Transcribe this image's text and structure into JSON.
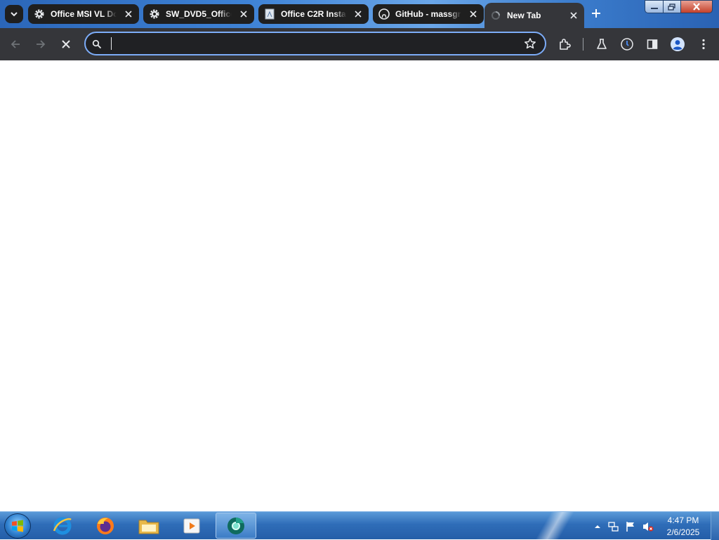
{
  "browser": {
    "tabs": [
      {
        "title": "Office MSI VL Do",
        "favicon": "gear-icon",
        "active": false
      },
      {
        "title": "SW_DVD5_Office",
        "favicon": "gear-icon",
        "active": false
      },
      {
        "title": "Office C2R Install",
        "favicon": "document-icon",
        "active": false
      },
      {
        "title": "GitHub - massgra",
        "favicon": "github-icon",
        "active": false
      },
      {
        "title": "New Tab",
        "favicon": "loading-icon",
        "active": true
      }
    ],
    "omnibox": {
      "value": "",
      "placeholder": ""
    },
    "toolbar_icons": [
      "back-icon",
      "forward-icon",
      "stop-icon",
      "bookmark-star-icon",
      "extensions-icon",
      "labs-icon",
      "performance-icon",
      "side-panel-icon",
      "profile-icon",
      "menu-icon"
    ]
  },
  "taskbar": {
    "pinned": [
      "internet-explorer-icon",
      "firefox-icon",
      "file-explorer-icon",
      "media-player-icon",
      "chrome-canary-icon"
    ],
    "tray_icons": [
      "show-hidden-icons",
      "network-icon",
      "action-center-flag-icon",
      "volume-muted-icon"
    ],
    "clock": {
      "time": "4:47 PM",
      "date": "2/6/2025"
    }
  },
  "colors": {
    "tab_bg": "#1f1f1f",
    "active_tab_bg": "#35363a",
    "toolbar_bg": "#35363a",
    "omnibox_focus": "#7cacf8",
    "taskbar": "#2f6db8"
  }
}
